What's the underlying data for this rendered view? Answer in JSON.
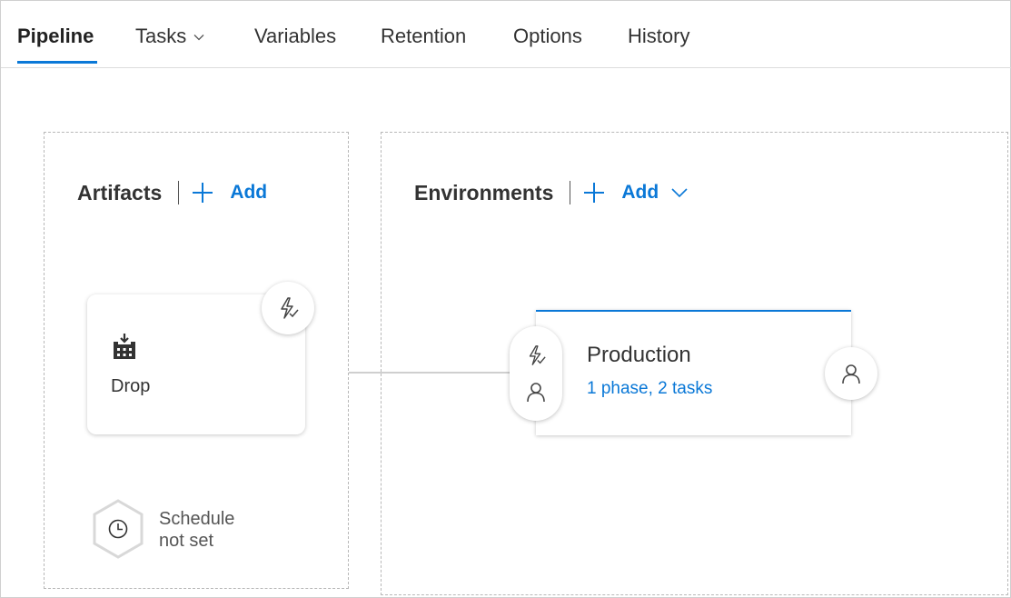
{
  "tabs": [
    {
      "label": "Pipeline",
      "active": true
    },
    {
      "label": "Tasks",
      "has_dropdown": true
    },
    {
      "label": "Variables"
    },
    {
      "label": "Retention"
    },
    {
      "label": "Options"
    },
    {
      "label": "History"
    }
  ],
  "artifacts": {
    "title": "Artifacts",
    "add_label": "Add",
    "add_icon": "plus-icon",
    "items": [
      {
        "name": "Drop",
        "icon": "build-icon",
        "trigger_icon": "lightning-trigger-icon"
      }
    ],
    "schedule": {
      "line1": "Schedule",
      "line2": "not set",
      "icon": "clock-icon"
    }
  },
  "environments": {
    "title": "Environments",
    "add_label": "Add",
    "add_icon": "plus-icon",
    "dropdown_icon": "chevron-down-icon",
    "items": [
      {
        "name": "Production",
        "summary": "1 phase, 2 tasks",
        "pre_icons": [
          "lightning-trigger-icon",
          "person-approval-icon"
        ],
        "post_icon": "person-approval-icon"
      }
    ]
  },
  "colors": {
    "accent": "#0a78d7",
    "text": "#333333",
    "border": "#b8b8b8"
  }
}
